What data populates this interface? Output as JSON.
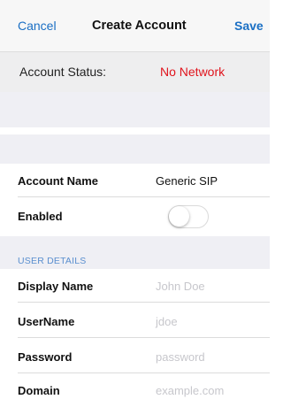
{
  "navbar": {
    "cancel_label": "Cancel",
    "title": "Create Account",
    "save_label": "Save"
  },
  "status": {
    "label": "Account Status:",
    "value": "No Network",
    "value_color": "#e0141d"
  },
  "account": {
    "name_label": "Account Name",
    "name_value": "Generic SIP",
    "enabled_label": "Enabled",
    "enabled_on": false
  },
  "user_details": {
    "section_title": "USER DETAILS",
    "display_name_label": "Display Name",
    "display_name_placeholder": "John Doe",
    "username_label": "UserName",
    "username_placeholder": "jdoe",
    "password_label": "Password",
    "password_placeholder": "password",
    "domain_label": "Domain",
    "domain_placeholder": "example.com"
  },
  "colors": {
    "accent": "#1a6fc4",
    "section_header_text": "#5a8fcf",
    "background_gray": "#efeff4"
  }
}
